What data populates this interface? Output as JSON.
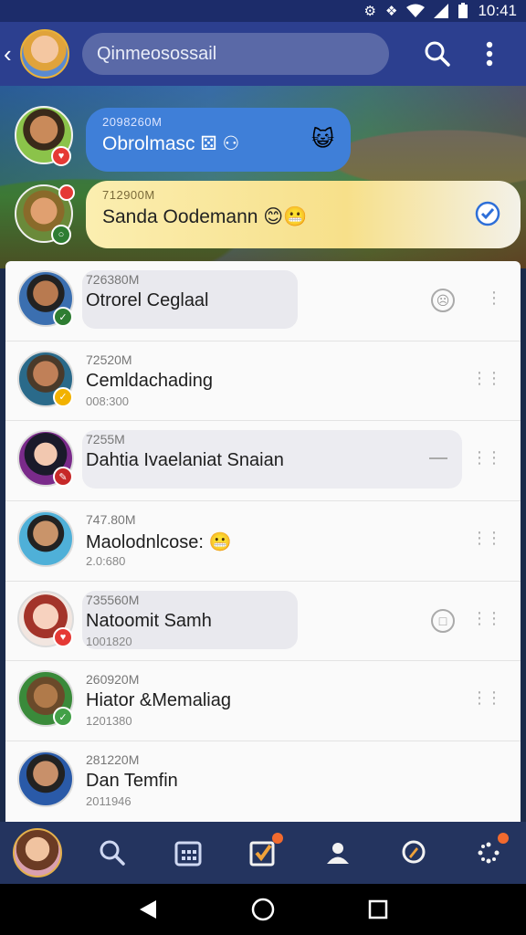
{
  "status_bar": {
    "time": "10:41",
    "icons": [
      "sync-icon",
      "mute-icon",
      "wifi-icon",
      "signal-icon",
      "battery-icon"
    ]
  },
  "header": {
    "search_text": "Qinmeosossail",
    "icons": [
      "back-icon",
      "search-icon",
      "more-vertical-icon"
    ]
  },
  "top_conversations": [
    {
      "time": "2098260M",
      "name": "Obrolmasc ⚄ ⚇",
      "emoji": "😺",
      "badge_color": "#e53935"
    },
    {
      "time": "712900M",
      "name": "Sanda Oodemann 😊😬",
      "badge_color": "#2e7d32"
    }
  ],
  "conversations": [
    {
      "time": "726380M",
      "name": "Otrorel Ceglaal",
      "sub": "",
      "badge_color": "#2e7d32"
    },
    {
      "time": "72520M",
      "name": "Cemldachading",
      "sub": "008:300",
      "badge_color": "#f2b200"
    },
    {
      "time": "7255M",
      "name": "Dahtia Ivaelaniat Snaian",
      "sub": "",
      "badge_color": "#c62828"
    },
    {
      "time": "747.80M",
      "name": "Maolodnlcose: 😬",
      "sub": "2.0:680",
      "badge_color": ""
    },
    {
      "time": "735560M",
      "name": "Natoomit Samh",
      "sub": "1001820",
      "badge_color": "#e53935"
    },
    {
      "time": "260920M",
      "name": "Hiator &Memaliag",
      "sub": "1201380",
      "badge_color": "#43a047"
    },
    {
      "time": "281220M",
      "name": "Dan Temfin",
      "sub": "2011946",
      "badge_color": ""
    }
  ],
  "bottom_nav": [
    "profile",
    "search",
    "calendar",
    "tasks",
    "contacts",
    "discover",
    "more"
  ],
  "colors": {
    "header": "#2c3f8f",
    "status_bar": "#1c2c6a",
    "bubble_blue": "#3f7fd8",
    "bubble_yellow": "#f7e08a",
    "list_bg": "#fafafa",
    "nav_bg": "#24345f"
  }
}
